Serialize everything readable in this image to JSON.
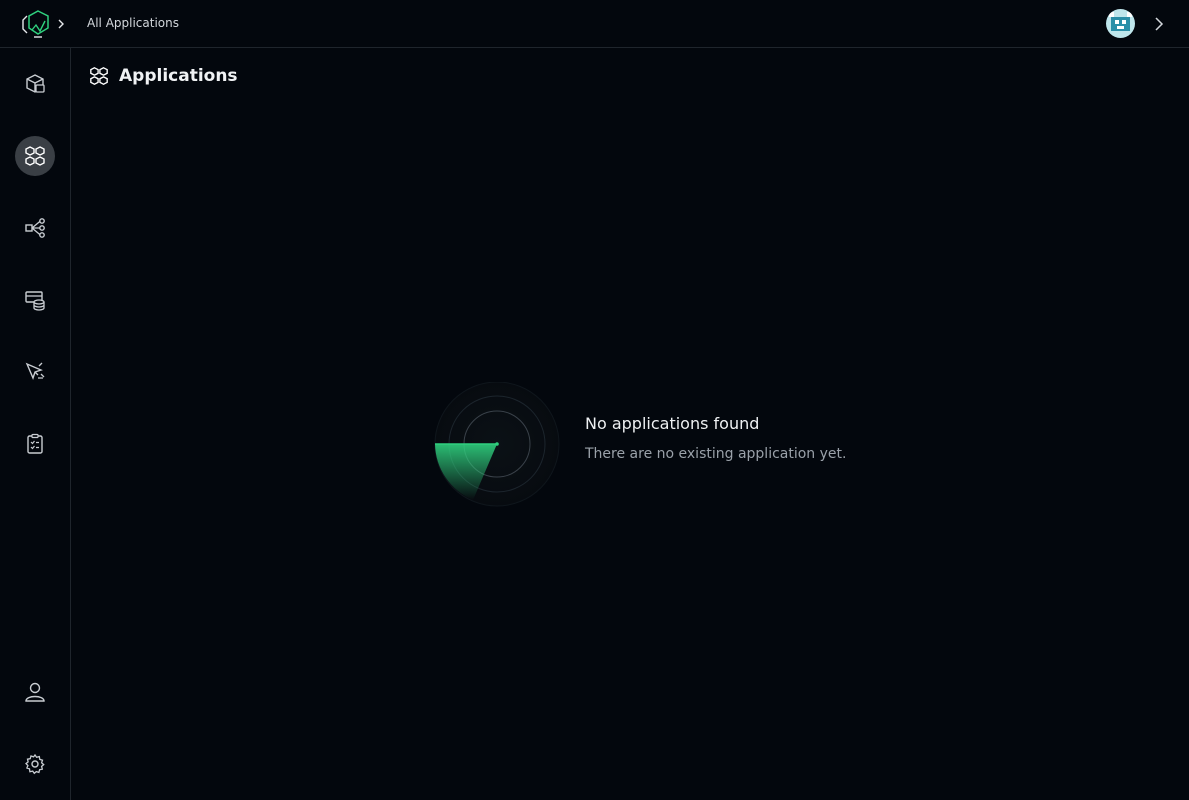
{
  "header": {
    "breadcrumb": "All Applications"
  },
  "sidebar": {
    "items": [
      {
        "icon": "package-icon"
      },
      {
        "icon": "applications-icon",
        "active": true
      },
      {
        "icon": "share-nodes-icon"
      },
      {
        "icon": "database-icon"
      },
      {
        "icon": "rocket-icon"
      },
      {
        "icon": "checklist-icon"
      },
      {
        "icon": "user-icon"
      },
      {
        "icon": "gear-icon"
      }
    ]
  },
  "main": {
    "title": "Applications",
    "empty": {
      "title": "No applications found",
      "description": "There are no existing application yet."
    }
  },
  "colors": {
    "background": "#03070d",
    "accent": "#2fd07e",
    "active_nav": "#3a3f45",
    "divider": "#1f252c"
  }
}
